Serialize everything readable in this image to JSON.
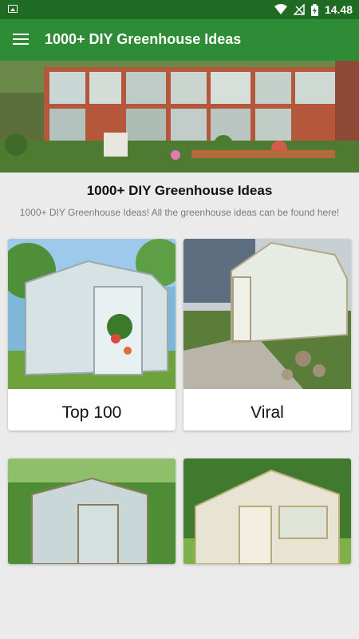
{
  "status_bar": {
    "time": "14.48"
  },
  "app_bar": {
    "title": "1000+ DIY Greenhouse Ideas"
  },
  "header": {
    "heading": "1000+ DIY Greenhouse Ideas",
    "subheading": "1000+ DIY Greenhouse Ideas! All the greenhouse ideas can be found here!"
  },
  "categories": [
    {
      "label": "Top 100"
    },
    {
      "label": "Viral"
    },
    {
      "label": ""
    },
    {
      "label": ""
    }
  ],
  "colors": {
    "status_bar": "#1f6b24",
    "app_bar": "#2e8b36",
    "background": "#ebebeb"
  }
}
